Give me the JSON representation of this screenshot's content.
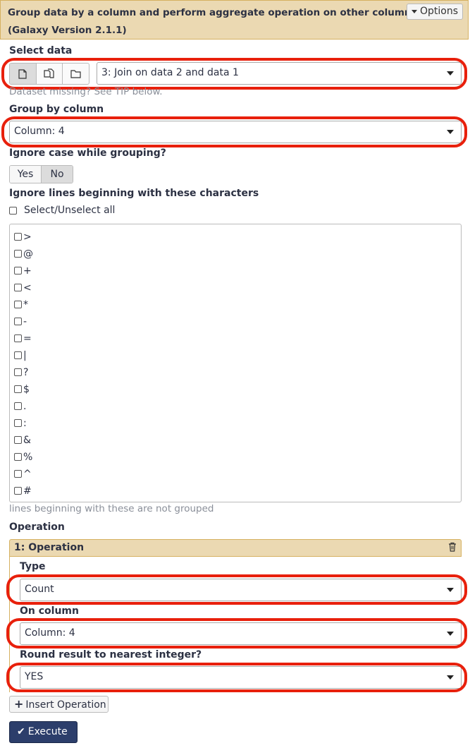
{
  "header": {
    "title": "Group data by a column and perform aggregate operation on other columns.",
    "version": "(Galaxy Version 2.1.1)",
    "options_label": "Options",
    "options_icon": "caret-down-icon"
  },
  "select_data": {
    "label": "Select data",
    "modes": [
      "single-dataset-icon",
      "multiple-datasets-icon",
      "dataset-collection-icon"
    ],
    "value": "3: Join on data 2 and data 1",
    "help": "Dataset missing? See TIP below."
  },
  "group_by": {
    "label": "Group by column",
    "value": "Column: 4"
  },
  "ignore_case": {
    "label": "Ignore case while grouping?",
    "yes": "Yes",
    "no": "No",
    "selected": "No"
  },
  "ignore_lines": {
    "label": "Ignore lines beginning with these characters",
    "select_all": "Select/Unselect all",
    "characters": [
      ">",
      "@",
      "+",
      "<",
      "*",
      "-",
      "=",
      "|",
      "?",
      "$",
      ".",
      ":",
      "&",
      "%",
      "^",
      "#"
    ],
    "help": "lines beginning with these are not grouped"
  },
  "operation": {
    "label": "Operation",
    "repeat_title": "1: Operation",
    "type_label": "Type",
    "type_value": "Count",
    "column_label": "On column",
    "column_value": "Column: 4",
    "round_label": "Round result to nearest integer?",
    "round_value": "YES"
  },
  "buttons": {
    "insert": "Insert Operation",
    "execute": "Execute"
  },
  "colors": {
    "header_bg": "#ebd9b2",
    "highlight_ring": "#e8200c",
    "execute_bg": "#2c3e6b"
  }
}
